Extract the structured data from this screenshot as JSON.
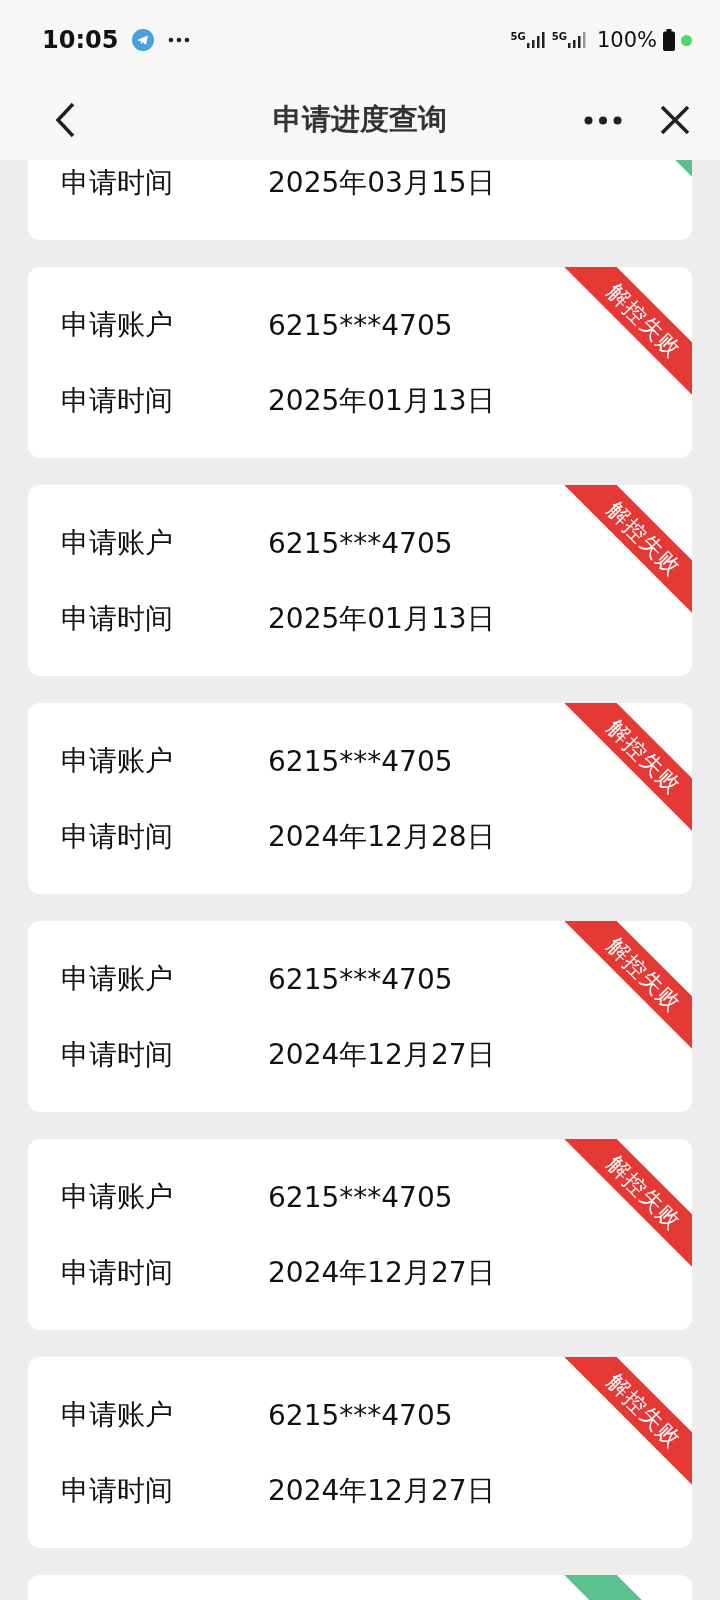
{
  "status_bar": {
    "time": "10:05",
    "signals": [
      "5G",
      "5G"
    ],
    "battery": "100%"
  },
  "nav": {
    "title": "申请进度查询"
  },
  "cards": [
    {
      "kind": "top",
      "color": "#5bbf8e",
      "rows": [
        {
          "label": "申请时间",
          "value": "2025年03月15日"
        }
      ]
    },
    {
      "kind": "full",
      "color": "#e53935",
      "ribbon": "解控失败",
      "rows": [
        {
          "label": "申请账户",
          "value": "6215***4705"
        },
        {
          "label": "申请时间",
          "value": "2025年01月13日"
        }
      ]
    },
    {
      "kind": "full",
      "color": "#e53935",
      "ribbon": "解控失败",
      "rows": [
        {
          "label": "申请账户",
          "value": "6215***4705"
        },
        {
          "label": "申请时间",
          "value": "2025年01月13日"
        }
      ]
    },
    {
      "kind": "full",
      "color": "#e53935",
      "ribbon": "解控失败",
      "rows": [
        {
          "label": "申请账户",
          "value": "6215***4705"
        },
        {
          "label": "申请时间",
          "value": "2024年12月28日"
        }
      ]
    },
    {
      "kind": "full",
      "color": "#e53935",
      "ribbon": "解控失败",
      "rows": [
        {
          "label": "申请账户",
          "value": "6215***4705"
        },
        {
          "label": "申请时间",
          "value": "2024年12月27日"
        }
      ]
    },
    {
      "kind": "full",
      "color": "#e53935",
      "ribbon": "解控失败",
      "rows": [
        {
          "label": "申请账户",
          "value": "6215***4705"
        },
        {
          "label": "申请时间",
          "value": "2024年12月27日"
        }
      ]
    },
    {
      "kind": "full",
      "color": "#e53935",
      "ribbon": "解控失败",
      "rows": [
        {
          "label": "申请账户",
          "value": "6215***4705"
        },
        {
          "label": "申请时间",
          "value": "2024年12月27日"
        }
      ]
    },
    {
      "kind": "bottom",
      "color": "#5bbf8e"
    }
  ]
}
